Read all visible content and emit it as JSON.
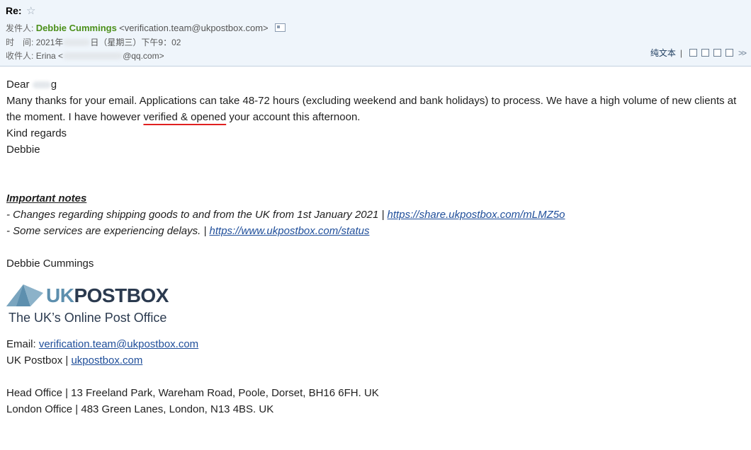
{
  "header": {
    "subject": "Re:",
    "from_label": "发件人:",
    "sender_name": "Debbie Cummings",
    "sender_email": "<verification.team@ukpostbox.com>",
    "time_label": "时　间:",
    "time_year": "2021年",
    "time_day": "日（星期三）下午9：02",
    "to_label": "收件人:",
    "to_name": "Erina",
    "to_lt": "<",
    "to_email_end": "@qq.com>"
  },
  "toolbar": {
    "plain_text": "纯文本",
    "separator": "|",
    "icons": [
      "window-icon",
      "print-preview-icon",
      "save-icon",
      "print-icon"
    ],
    "more": ">>"
  },
  "email": {
    "greeting_prefix": "Dear",
    "greeting_suffix": "g",
    "p1_a": "Many thanks for your email. Applications can take 48-72 hours (excluding weekend and bank holidays) to process. We have a high volume of new clients at the moment. I have however ",
    "p1_highlight": "verified & opened",
    "p1_b": " your account this afternoon.",
    "closing": "Kind regards",
    "signoff": "Debbie",
    "notes_title": "Important notes",
    "note1_text": "- Changes regarding shipping goods to and from the UK from 1st January 2021 | ",
    "note1_link": "https://share.ukpostbox.com/mLMZ5o",
    "note2_text": "- Some services are experiencing delays. | ",
    "note2_link": "https://www.ukpostbox.com/status",
    "signature_name": "Debbie Cummings",
    "logo_uk": "UK",
    "logo_postbox": "POSTBOX",
    "tagline": "The UK’s Online Post Office",
    "email_label": "Email: ",
    "email_link": "verification.team@ukpostbox.com",
    "site_label": "UK Postbox | ",
    "site_link": "ukpostbox.com",
    "head_office": "Head Office | 13 Freeland Park, Wareham Road, Poole, Dorset, BH16 6FH. UK",
    "london_office": "London Office | 483 Green Lanes, London, N13 4BS. UK"
  },
  "colors": {
    "header_bg": "#eff5fb",
    "sender_green": "#4b8f1a",
    "link_blue": "#1f4e9a",
    "underline_red": "#e02020",
    "logo_light": "#5d8fae",
    "logo_dark": "#2b3a4f"
  }
}
